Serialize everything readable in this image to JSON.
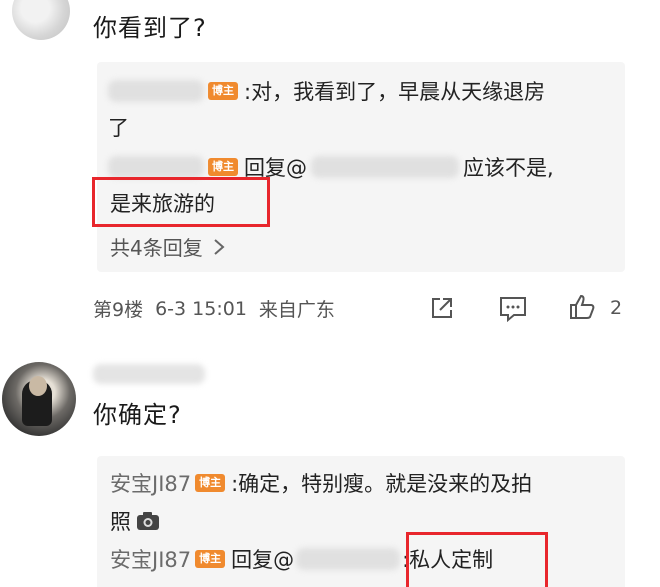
{
  "comment1": {
    "text": "你看到了?",
    "replies": [
      {
        "badge": "博主",
        "text": ":对，我看到了，早晨从天缘退房",
        "text_cont": "了"
      },
      {
        "badge": "博主",
        "prefix": "回复@",
        "text": "应该不是,",
        "text_cont": "是来旅游的"
      }
    ],
    "more_label": "共4条回复",
    "floor": "第9楼",
    "date": "6-3 15:01",
    "location": "来自广东",
    "like_count": "2"
  },
  "comment2": {
    "text": "你确定?",
    "replies": [
      {
        "user": "安宝JI87",
        "badge": "博主",
        "text": ":确定，特别瘦。就是没来的及拍",
        "text_cont": "照"
      },
      {
        "user": "安宝JI87",
        "badge": "博主",
        "prefix": "回复@",
        "text": ":私人定制"
      }
    ]
  },
  "colors": {
    "highlight": "#e8262c",
    "badge": "#f08a2e",
    "reply_bg": "#f5f5f5"
  },
  "icons": [
    "share-icon",
    "comment-icon",
    "like-icon",
    "camera-icon",
    "chevron-right-icon"
  ]
}
